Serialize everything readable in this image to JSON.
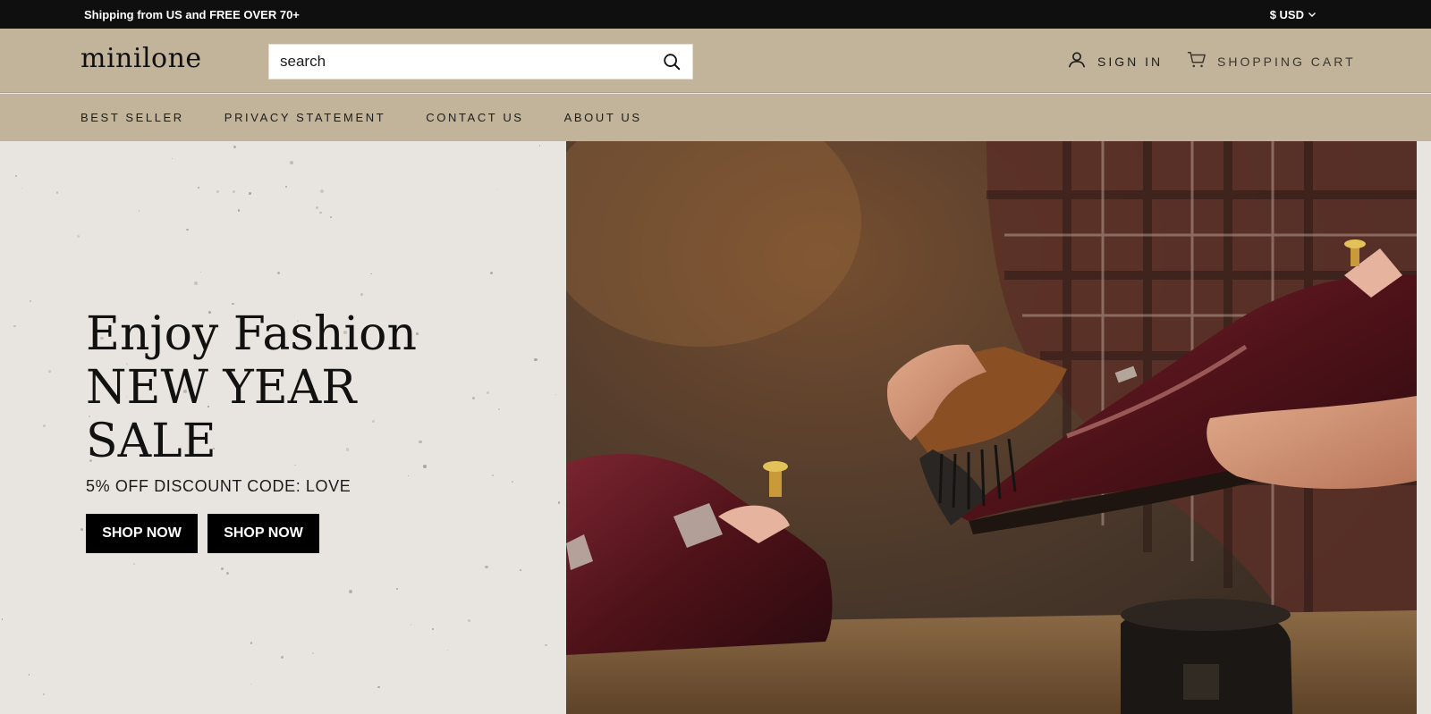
{
  "topbar": {
    "announcement": "Shipping from US and FREE OVER 70+",
    "currency": "$ USD"
  },
  "header": {
    "logo": "minilone",
    "search_placeholder": "search",
    "sign_in": "SIGN IN",
    "cart": "SHOPPING CART"
  },
  "nav": {
    "items": [
      {
        "label": "BEST SELLER"
      },
      {
        "label": "PRIVACY STATEMENT"
      },
      {
        "label": "CONTACT US"
      },
      {
        "label": "ABOUT US"
      }
    ]
  },
  "hero": {
    "title_lines": [
      "Enjoy Fashion",
      "NEW YEAR",
      "SALE"
    ],
    "subtitle": "5% OFF DISCOUNT CODE: LOVE",
    "buttons": [
      {
        "label": "SHOP NOW"
      },
      {
        "label": "SHOP NOW"
      }
    ]
  },
  "colors": {
    "topbar_bg": "#0f0f0f",
    "header_bg": "#c1b49a",
    "hero_left_bg": "#e8e5e0",
    "button_bg": "#000000"
  },
  "icons": {
    "currency": "chevron-down-icon",
    "search": "search-icon",
    "sign_in": "user-icon",
    "cart": "cart-icon"
  }
}
